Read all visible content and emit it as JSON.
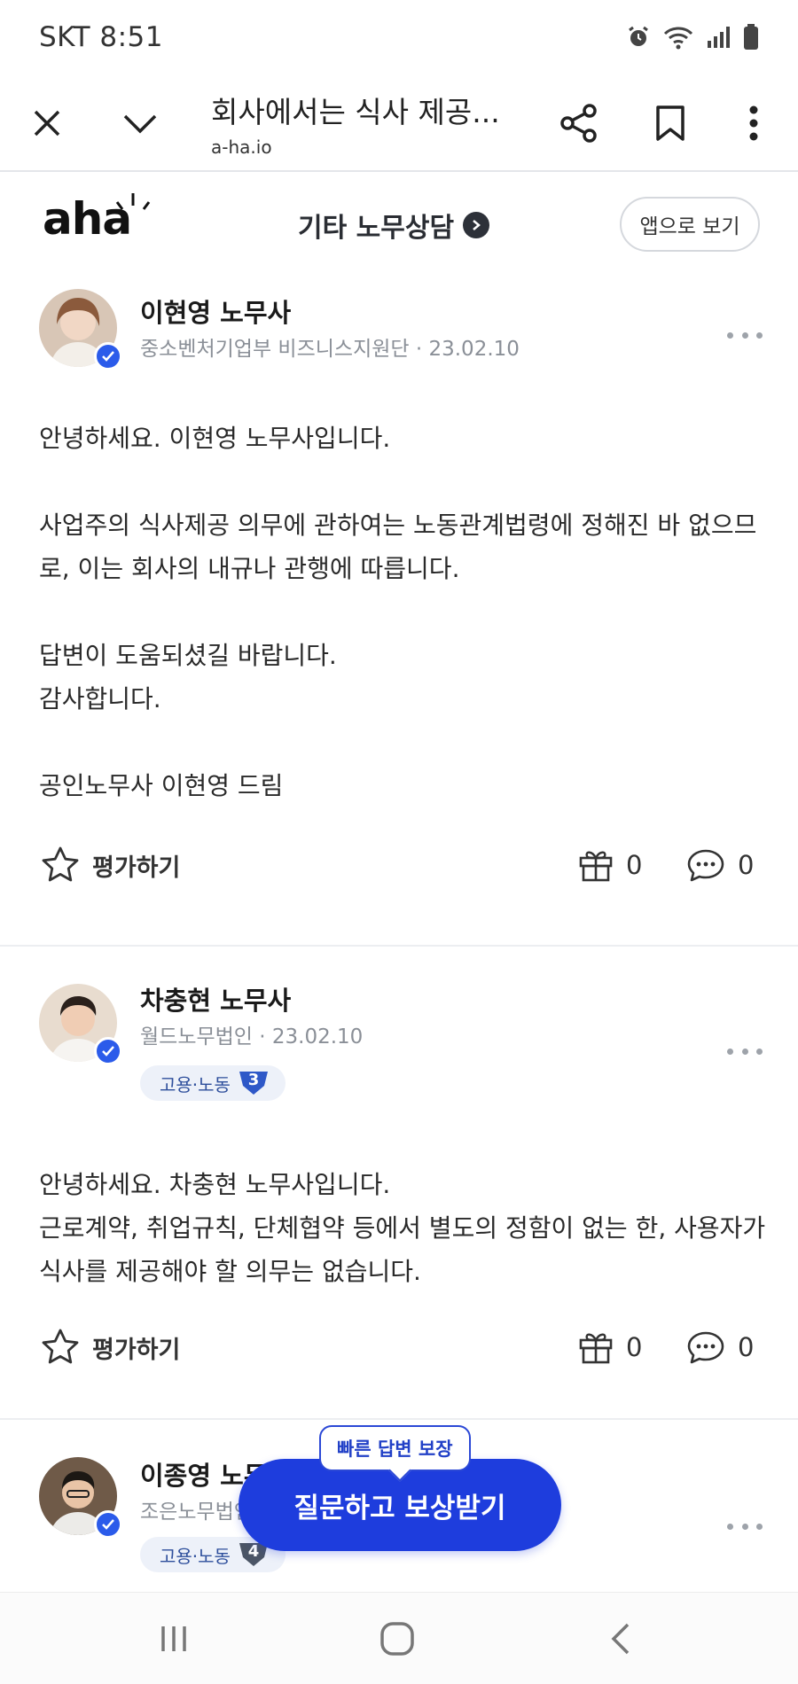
{
  "status": {
    "carrier_time": "SKT 8:51"
  },
  "toolbar": {
    "title": "회사에서는 식사 제공...",
    "url": "a-ha.io"
  },
  "site": {
    "logo": "aha",
    "category": "기타 노무상담",
    "app_button": "앱으로 보기"
  },
  "answers": [
    {
      "name": "이현영 노무사",
      "meta": "중소벤처기업부 비즈니스지원단 · 23.02.10",
      "body": "안녕하세요. 이현영 노무사입니다.\n\n사업주의 식사제공 의무에 관하여는 노동관계법령에 정해진 바 없으므로, 이는 회사의 내규나 관행에 따릅니다.\n\n답변이 도움되셨길 바랍니다.\n감사합니다.\n\n공인노무사 이현영 드림",
      "rate_label": "평가하기",
      "gift_count": "0",
      "comment_count": "0"
    },
    {
      "name": "차충현 노무사",
      "meta": "월드노무법인 · 23.02.10",
      "badge": "고용·노동",
      "badge_level": "3",
      "body": "안녕하세요. 차충현 노무사입니다.\n근로계약, 취업규칙, 단체협약 등에서 별도의 정함이 없는 한, 사용자가 식사를 제공해야 할 의무는 없습니다.",
      "rate_label": "평가하기",
      "gift_count": "0",
      "comment_count": "0"
    },
    {
      "name": "이종영 노무사",
      "meta": "조은노무법인",
      "badge": "고용·노동",
      "badge_level": "4"
    }
  ],
  "cta": {
    "label": "질문하고 보상받기",
    "tooltip": "빠른 답변 보장"
  },
  "colors": {
    "accent": "#1e3ddd",
    "verified": "#2b5bea",
    "badge_bg": "#edf1f9"
  }
}
